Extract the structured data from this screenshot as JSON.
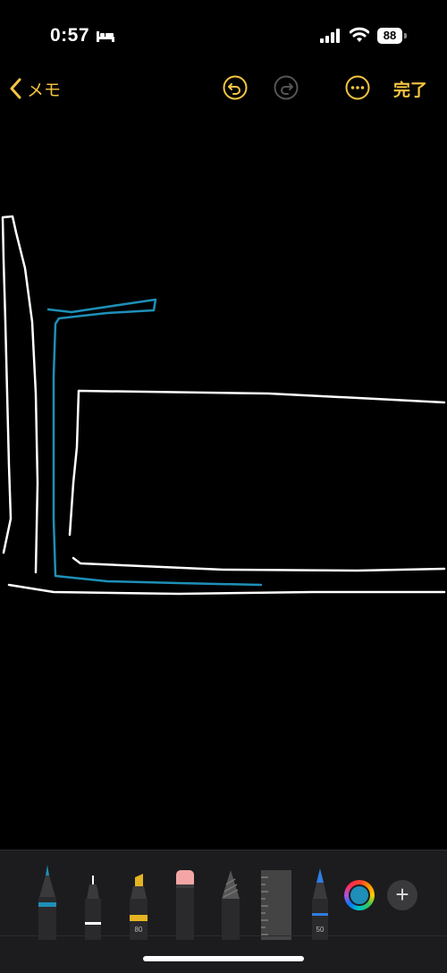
{
  "status_bar": {
    "time": "0:57",
    "battery_level": "88",
    "icons": [
      "bed-icon",
      "cellular-icon",
      "wifi-icon",
      "battery-icon"
    ]
  },
  "nav": {
    "back_label": "メモ",
    "done_label": "完了",
    "icons": [
      "chevron-left-icon",
      "undo-icon",
      "redo-icon",
      "more-icon"
    ],
    "accent_color": "#f5c542"
  },
  "canvas": {
    "stroke_colors": {
      "white": "#ffffff",
      "blue": "#1e8fb8"
    }
  },
  "toolbar": {
    "tools": [
      {
        "name": "pen",
        "icon": "pen-icon",
        "color": "#1e8fb8",
        "label": ""
      },
      {
        "name": "fineliner",
        "icon": "fineliner-icon",
        "color": "#ffffff",
        "label": ""
      },
      {
        "name": "highlighter",
        "icon": "highlighter-icon",
        "color": "#e6b422",
        "label": "80"
      },
      {
        "name": "eraser",
        "icon": "eraser-icon",
        "color": "#f4a6a6",
        "label": ""
      },
      {
        "name": "pencil",
        "icon": "pencil-icon",
        "color": "#555555",
        "label": ""
      },
      {
        "name": "ruler",
        "icon": "ruler-icon",
        "color": "#444444",
        "label": ""
      },
      {
        "name": "crayon",
        "icon": "crayon-icon",
        "color": "#2f7de1",
        "label": "50"
      }
    ],
    "selected_color": "#1e8fb8",
    "add_label": "+"
  }
}
